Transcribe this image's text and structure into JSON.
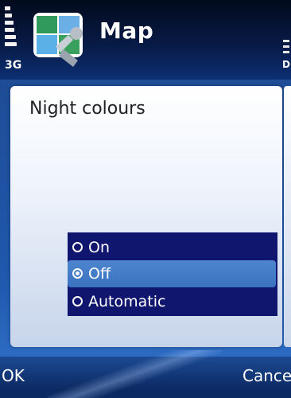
{
  "status": {
    "network": "3G",
    "right_indicator": "D"
  },
  "header": {
    "app_title": "Map",
    "icon": "map-app-icon"
  },
  "dialog": {
    "title": "Night colours",
    "options": [
      {
        "label": "On",
        "selected": false
      },
      {
        "label": "Off",
        "selected": true
      },
      {
        "label": "Automatic",
        "selected": false
      }
    ]
  },
  "softkeys": {
    "left": "OK",
    "right": "Cancel"
  },
  "colors": {
    "list_background": "#10156e",
    "selection": "#3a72c0",
    "title_bar": "#071a45"
  }
}
